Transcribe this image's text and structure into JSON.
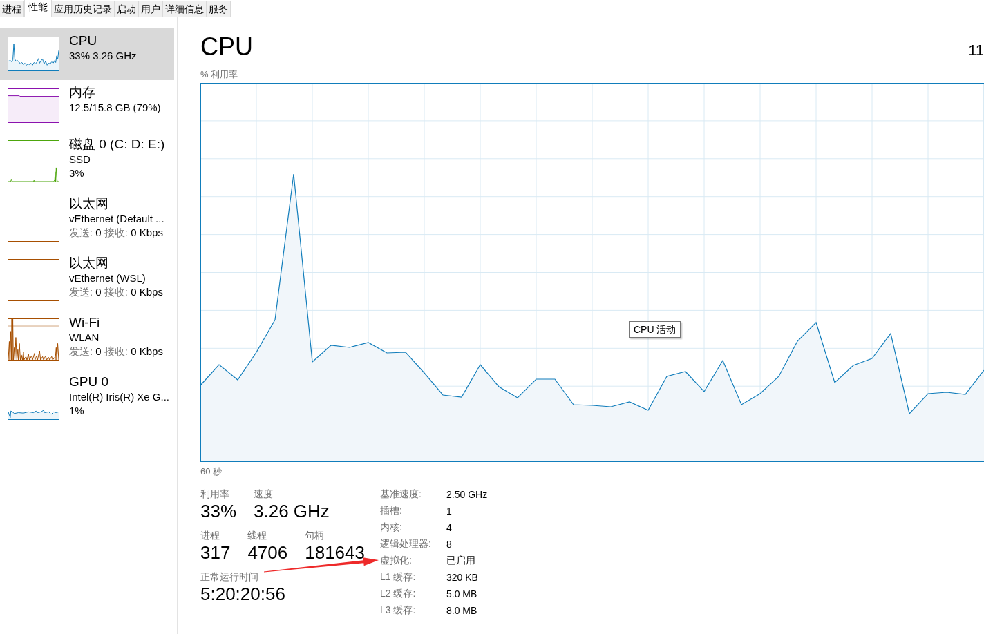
{
  "tabs": [
    {
      "label": "进程",
      "selected": false
    },
    {
      "label": "性能",
      "selected": true
    },
    {
      "label": "应用历史记录",
      "selected": false
    },
    {
      "label": "启动",
      "selected": false
    },
    {
      "label": "用户",
      "selected": false
    },
    {
      "label": "详细信息",
      "selected": false
    },
    {
      "label": "服务",
      "selected": false
    }
  ],
  "sidebar": {
    "items": [
      {
        "title": "CPU",
        "selected": true,
        "color": "#117dbb",
        "lines": [
          {
            "kind": "text",
            "text": "33% 3.26 GHz"
          }
        ]
      },
      {
        "title": "内存",
        "selected": false,
        "color": "#8b12ae",
        "lines": [
          {
            "kind": "text",
            "text": "12.5/15.8 GB (79%)"
          }
        ]
      },
      {
        "title": "磁盘 0 (C: D: E:)",
        "selected": false,
        "color": "#4da60c",
        "lines": [
          {
            "kind": "text",
            "text": "SSD"
          },
          {
            "kind": "text",
            "text": "3%"
          }
        ]
      },
      {
        "title": "以太网",
        "selected": false,
        "color": "#a74f01",
        "lines": [
          {
            "kind": "text",
            "text": "vEthernet (Default ..."
          },
          {
            "kind": "rate",
            "sent_label": "发送:",
            "sent": "0",
            "received_label": "接收:",
            "received": "0 Kbps"
          }
        ]
      },
      {
        "title": "以太网",
        "selected": false,
        "color": "#a74f01",
        "lines": [
          {
            "kind": "text",
            "text": "vEthernet (WSL)"
          },
          {
            "kind": "rate",
            "sent_label": "发送:",
            "sent": "0",
            "received_label": "接收:",
            "received": "0 Kbps"
          }
        ]
      },
      {
        "title": "Wi-Fi",
        "selected": false,
        "color": "#a74f01",
        "lines": [
          {
            "kind": "text",
            "text": "WLAN"
          },
          {
            "kind": "rate",
            "sent_label": "发送:",
            "sent": "0",
            "received_label": "接收:",
            "received": "0 Kbps"
          }
        ]
      },
      {
        "title": "GPU 0",
        "selected": false,
        "color": "#117dbb",
        "lines": [
          {
            "kind": "text",
            "text": "Intel(R) Iris(R) Xe G..."
          },
          {
            "kind": "text",
            "text": "1%"
          }
        ]
      }
    ]
  },
  "detail": {
    "title": "CPU",
    "right_text": "11",
    "graph": {
      "ylabel": "% 利用率",
      "xlabel": "60 秒",
      "tooltip": "CPU 活动"
    },
    "stat_rows": [
      {
        "items": [
          {
            "label": "利用率",
            "value": "33%"
          },
          {
            "label": "速度",
            "value": "3.26 GHz"
          }
        ]
      },
      {
        "items": [
          {
            "label": "进程",
            "value": "317"
          },
          {
            "label": "线程",
            "value": "4706"
          },
          {
            "label": "句柄",
            "value": "181643"
          }
        ]
      },
      {
        "items": [
          {
            "label": "正常运行时间",
            "value": "5:20:20:56"
          }
        ]
      }
    ],
    "properties": [
      {
        "label": "基准速度:",
        "value": "2.50 GHz"
      },
      {
        "label": "插槽:",
        "value": "1"
      },
      {
        "label": "内核:",
        "value": "4"
      },
      {
        "label": "逻辑处理器:",
        "value": "8"
      },
      {
        "label": "虚拟化:",
        "value": "已启用"
      },
      {
        "label": "L1 缓存:",
        "value": "320 KB"
      },
      {
        "label": "L2 缓存:",
        "value": "5.0 MB"
      },
      {
        "label": "L3 缓存:",
        "value": "8.0 MB"
      }
    ]
  }
}
